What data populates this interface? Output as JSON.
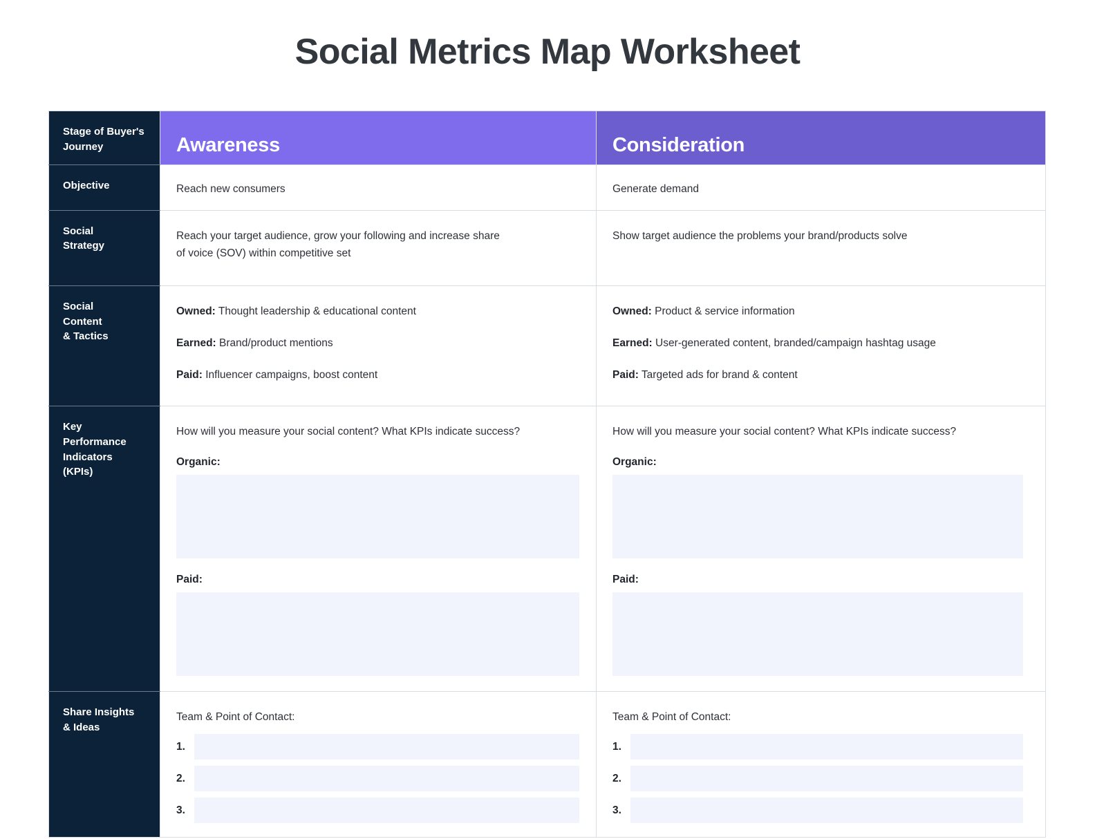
{
  "title": "Social Metrics Map Worksheet",
  "colors": {
    "awareness_header": "#7f6ced",
    "consideration_header": "#6d5ed0",
    "label_column": "#0c2238",
    "input_fill": "#f2f4fd",
    "border": "#d8dce3",
    "title_text": "#33383f"
  },
  "row_labels": {
    "stage": "Stage of Buyer's\nJourney",
    "stage_line1": "Stage of Buyer's",
    "stage_line2": "Journey",
    "objective": "Objective",
    "strategy_line1": "Social",
    "strategy_line2": "Strategy",
    "content_line1": "Social",
    "content_line2": "Content",
    "content_line3": "& Tactics",
    "kpi_line1": "Key",
    "kpi_line2": "Performance",
    "kpi_line3": "Indicators",
    "kpi_line4": "(KPIs)",
    "share_line1": "Share Insights",
    "share_line2": "& Ideas"
  },
  "columns": {
    "awareness": {
      "header": "Awareness",
      "objective": "Reach new consumers",
      "strategy_line1": "Reach your target audience, grow your following and increase share",
      "strategy_line2": "of voice (SOV) within competitive set",
      "tactics": {
        "owned_label": "Owned:",
        "owned_text": " Thought leadership & educational content",
        "earned_label": "Earned:",
        "earned_text": " Brand/product mentions",
        "paid_label": "Paid:",
        "paid_text": " Influencer campaigns, boost content"
      },
      "kpi": {
        "question": "How will you measure your social content? What KPIs indicate success?",
        "organic_label": "Organic:",
        "organic_value": "",
        "organic_placeholder": "",
        "paid_label": "Paid:",
        "paid_value": "",
        "paid_placeholder": ""
      },
      "share": {
        "contact_label": "Team & Point of Contact:",
        "items": [
          {
            "num": "1.",
            "value": "",
            "placeholder": ""
          },
          {
            "num": "2.",
            "value": "",
            "placeholder": ""
          },
          {
            "num": "3.",
            "value": "",
            "placeholder": ""
          }
        ]
      }
    },
    "consideration": {
      "header": "Consideration",
      "objective": "Generate demand",
      "strategy_line1": "Show target audience the problems your brand/products solve",
      "strategy_line2": "",
      "tactics": {
        "owned_label": "Owned:",
        "owned_text": " Product & service information",
        "earned_label": "Earned:",
        "earned_text": " User-generated content, branded/campaign hashtag usage",
        "paid_label": "Paid:",
        "paid_text": " Targeted ads for brand & content"
      },
      "kpi": {
        "question": "How will you measure your social content? What KPIs indicate success?",
        "organic_label": "Organic:",
        "organic_value": "",
        "organic_placeholder": "",
        "paid_label": "Paid:",
        "paid_value": "",
        "paid_placeholder": ""
      },
      "share": {
        "contact_label": "Team & Point of Contact:",
        "items": [
          {
            "num": "1.",
            "value": "",
            "placeholder": ""
          },
          {
            "num": "2.",
            "value": "",
            "placeholder": ""
          },
          {
            "num": "3.",
            "value": "",
            "placeholder": ""
          }
        ]
      }
    }
  }
}
